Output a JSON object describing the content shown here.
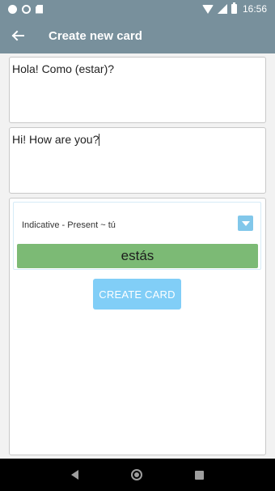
{
  "status_bar": {
    "time": "16:56"
  },
  "app_bar": {
    "title": "Create new card",
    "back_icon": "arrow-left-icon"
  },
  "front_text": {
    "value": "Hola! Como (estar)?"
  },
  "back_text": {
    "value": "Hi! How are you?"
  },
  "conjugation": {
    "selected": "Indicative - Present ~ tú",
    "answer": "estás",
    "arrow_icon": "chevron-down-icon"
  },
  "create_button": {
    "label": "CREATE CARD"
  },
  "colors": {
    "app_bar": "#78909c",
    "answer_bg": "#7cba75",
    "button_bg": "#81cef7",
    "select_arrow_bg": "#81c7ea"
  }
}
